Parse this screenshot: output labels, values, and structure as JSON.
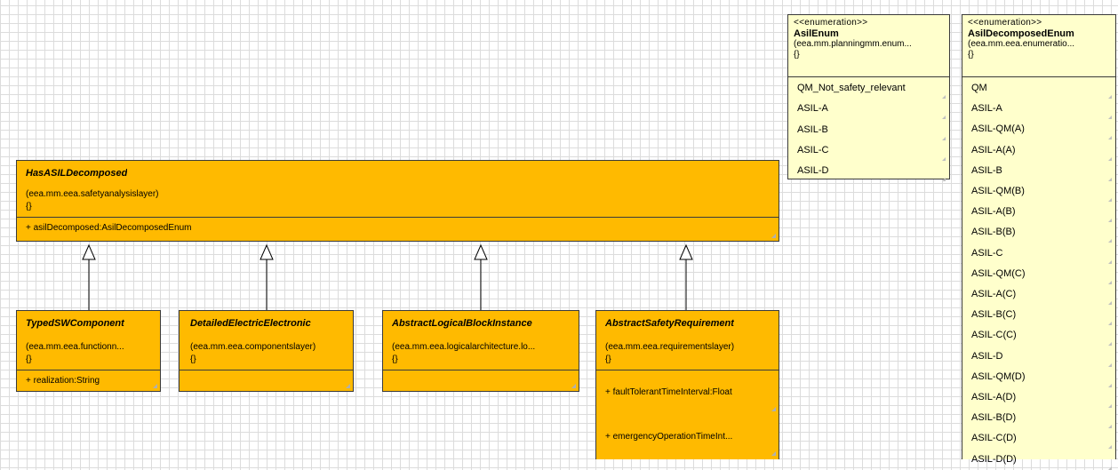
{
  "enum_asil": {
    "stereotype": "<<enumeration>>",
    "name": "AsilEnum",
    "package": "(eea.mm.planningmm.enum...",
    "brace": "{}",
    "literals": [
      "QM_Not_safety_relevant",
      "ASIL-A",
      "ASIL-B",
      "ASIL-C",
      "ASIL-D"
    ]
  },
  "enum_decomposed": {
    "stereotype": "<<enumeration>>",
    "name": "AsilDecomposedEnum",
    "package": "(eea.mm.eea.enumeratio...",
    "brace": "{}",
    "literals": [
      "QM",
      "ASIL-A",
      "ASIL-QM(A)",
      "ASIL-A(A)",
      "ASIL-B",
      "ASIL-QM(B)",
      "ASIL-A(B)",
      "ASIL-B(B)",
      "ASIL-C",
      "ASIL-QM(C)",
      "ASIL-A(C)",
      "ASIL-B(C)",
      "ASIL-C(C)",
      "ASIL-D",
      "ASIL-QM(D)",
      "ASIL-A(D)",
      "ASIL-B(D)",
      "ASIL-C(D)",
      "ASIL-D(D)"
    ]
  },
  "has_asil": {
    "name": "HasASILDecomposed",
    "package": "(eea.mm.eea.safetyanalysislayer)",
    "brace": "{}",
    "attribute": "+  asilDecomposed:AsilDecomposedEnum"
  },
  "typed_sw": {
    "name": "TypedSWComponent",
    "package": "(eea.mm.eea.functionn...",
    "brace": "{}",
    "attribute": "+  realization:String"
  },
  "detailed_ee": {
    "name": "DetailedElectricElectronic",
    "package": "(eea.mm.eea.componentslayer)",
    "brace": "{}"
  },
  "abstract_lbi": {
    "name": "AbstractLogicalBlockInstance",
    "package": "(eea.mm.eea.logicalarchitecture.lo...",
    "brace": "{}"
  },
  "abstract_sr": {
    "name": "AbstractSafetyRequirement",
    "package": "(eea.mm.eea.requirementslayer)",
    "brace": "{}",
    "attribute_1": "+  faultTolerantTimeInterval:Float",
    "attribute_2": "+  emergencyOperationTimeInt..."
  },
  "colors": {
    "class_fill": "#ffba00",
    "enum_fill": "#ffffcc",
    "border": "#3a3a3a",
    "grid": "#dcdcdc"
  }
}
